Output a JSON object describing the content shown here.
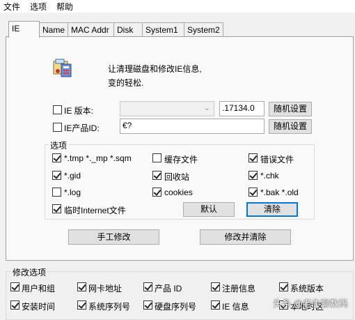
{
  "menu": [
    "文件",
    "选项",
    "帮助"
  ],
  "tabs": [
    "IE",
    "Name",
    "MAC Addr",
    "Disk",
    "System1",
    "System2"
  ],
  "intro": {
    "line1": "让清理磁盘和修改IE信息,",
    "line2": "变的轻松."
  },
  "ie_version": {
    "label": "IE 版本:",
    "checked": false,
    "dropdown_value": "",
    "value": ".17134.0",
    "random_button": "随机设置"
  },
  "ie_product_id": {
    "label": "IE产品ID:",
    "checked": false,
    "value": "€?",
    "random_button": "随机设置"
  },
  "options": {
    "title": "选项",
    "items": [
      {
        "label": "*.tmp  *._mp  *.sqm",
        "checked": true
      },
      {
        "label": "缓存文件",
        "checked": false
      },
      {
        "label": "错误文件",
        "checked": true
      },
      {
        "label": "*.gid",
        "checked": true
      },
      {
        "label": "回收站",
        "checked": true
      },
      {
        "label": "*.chk",
        "checked": true
      },
      {
        "label": "*.log",
        "checked": false
      },
      {
        "label": "cookies",
        "checked": true
      },
      {
        "label": "*.bak  *.old",
        "checked": true
      },
      {
        "label": "临时Internet文件",
        "checked": true
      }
    ],
    "default_button": "默认",
    "clear_button": "清除"
  },
  "manual_button": "手工修改",
  "modify_clear_button": "修改并清除",
  "modify_options": {
    "title": "修改选项",
    "items": [
      {
        "label": "用户和组",
        "checked": true
      },
      {
        "label": "网卡地址",
        "checked": true
      },
      {
        "label": "产品 ID",
        "checked": true
      },
      {
        "label": "注册信息",
        "checked": true
      },
      {
        "label": "系统版本",
        "checked": true
      },
      {
        "label": "安装时间",
        "checked": true
      },
      {
        "label": "系统序列号",
        "checked": true
      },
      {
        "label": "硬盘序列号",
        "checked": true
      },
      {
        "label": "IE 信息",
        "checked": true
      },
      {
        "label": "本地时区",
        "checked": true
      }
    ]
  },
  "watermark": "头条 @老牛聊数码",
  "colors": {
    "focus": "#0078d7",
    "panel": "#f9f9f9",
    "window": "#f0f0f0"
  }
}
